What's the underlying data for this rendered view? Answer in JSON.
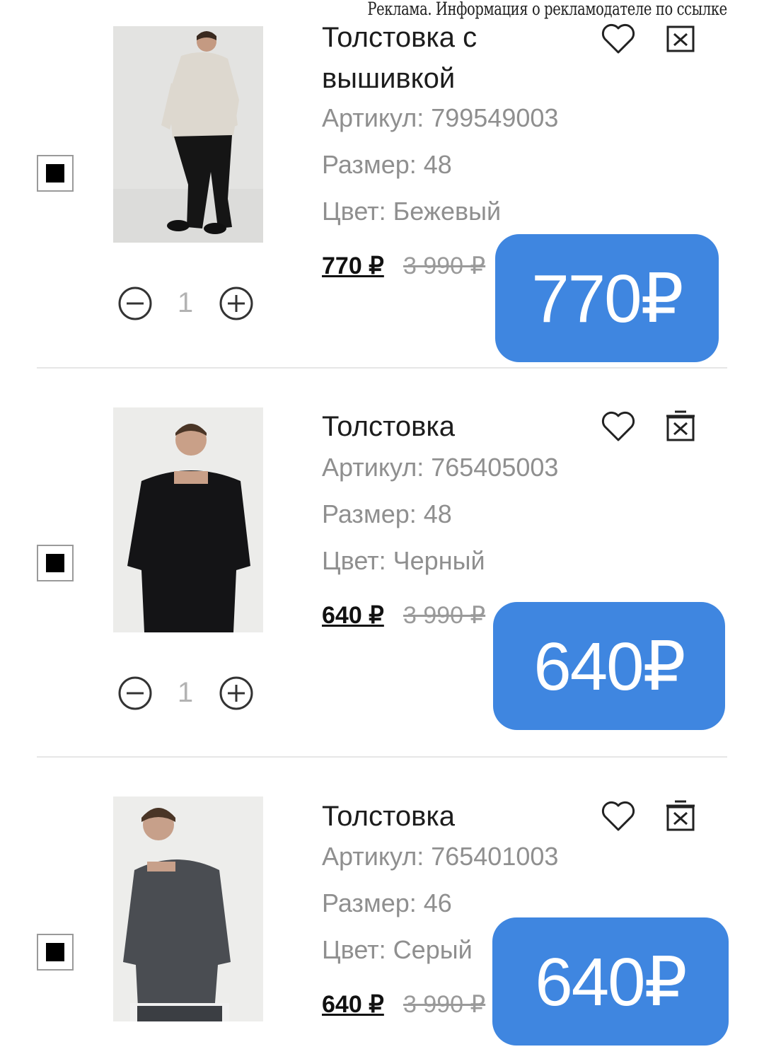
{
  "ad_note": "Реклама. Информация о рекламодателе по ссылке",
  "accent_color": "#3f86e0",
  "items": [
    {
      "title": "Толстовка с вышивкой",
      "article": "Артикул: 799549003",
      "size": "Размер: 48",
      "color": "Цвет: Бежевый",
      "price": "770 ₽",
      "old_price": "3 990 ₽",
      "quantity": "1",
      "badge": "770₽",
      "selected": true
    },
    {
      "title": "Толстовка",
      "article": "Артикул: 765405003",
      "size": "Размер: 48",
      "color": "Цвет: Черный",
      "price": "640 ₽",
      "old_price": "3 990 ₽",
      "quantity": "1",
      "badge": "640₽",
      "selected": true
    },
    {
      "title": "Толстовка",
      "article": "Артикул: 765401003",
      "size": "Размер: 46",
      "color": "Цвет: Серый",
      "price": "640 ₽",
      "old_price": "3 990 ₽",
      "badge": "640₽",
      "selected": true
    }
  ],
  "icons": {
    "favorite": "heart-icon",
    "delete": "trash-icon",
    "decrease": "minus-icon",
    "increase": "plus-icon"
  }
}
